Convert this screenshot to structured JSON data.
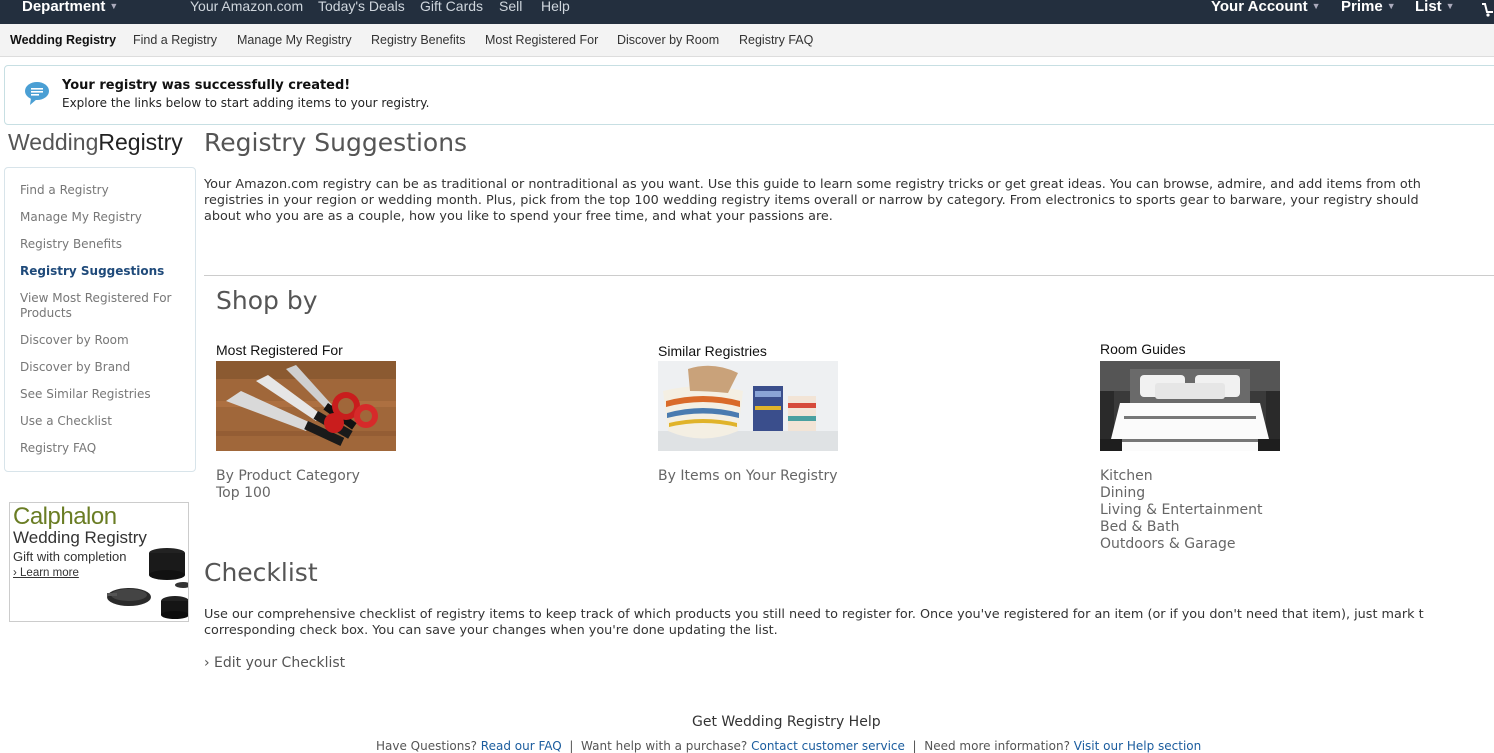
{
  "topnav": {
    "department": "Department",
    "links": [
      "Your Amazon.com",
      "Today's Deals",
      "Gift Cards",
      "Sell",
      "Help"
    ],
    "account": "Your Account",
    "prime": "Prime",
    "list": "List"
  },
  "subnav": {
    "items": [
      "Wedding Registry",
      "Find a Registry",
      "Manage My Registry",
      "Registry Benefits",
      "Most Registered For",
      "Discover by Room",
      "Registry FAQ"
    ]
  },
  "alert": {
    "title": "Your registry was successfully created!",
    "message": "Explore the links below to start adding items to your registry."
  },
  "sidebar": {
    "logo_light": "Wedding",
    "logo_strong": "Registry",
    "items": [
      {
        "label": "Find a Registry"
      },
      {
        "label": "Manage My Registry"
      },
      {
        "label": "Registry Benefits"
      },
      {
        "label": "Registry Suggestions",
        "active": true
      },
      {
        "label": "View Most Registered For Products"
      },
      {
        "label": "Discover by Room"
      },
      {
        "label": "Discover by Brand"
      },
      {
        "label": "See Similar Registries"
      },
      {
        "label": "Use a Checklist"
      },
      {
        "label": "Registry FAQ"
      }
    ]
  },
  "ad": {
    "brand": "Calphalon",
    "line2": "Wedding Registry",
    "line3": "Gift with completion",
    "learn": "Learn more"
  },
  "main": {
    "title": "Registry Suggestions",
    "intro": [
      "Your Amazon.com registry can be as traditional or nontraditional as you want. Use this guide to learn some registry tricks or get great ideas. You can browse, admire, and add items from oth",
      "registries in your region or wedding month. Plus, pick from the top 100 wedding registry items overall or narrow by category. From electronics to sports gear to barware, your registry should",
      "about who you are as a couple, how you like to spend your free time, and what your passions are."
    ],
    "shop_by": "Shop by",
    "columns": [
      {
        "title": "Most Registered For",
        "links": [
          "By Product Category",
          "Top 100"
        ]
      },
      {
        "title": "Similar Registries",
        "links": [
          "By Items on Your Registry"
        ]
      },
      {
        "title": "Room Guides",
        "links": [
          "Kitchen",
          "Dining",
          "Living & Entertainment",
          "Bed & Bath",
          "Outdoors & Garage"
        ]
      }
    ],
    "checklist_title": "Checklist",
    "checklist_text": [
      "Use our comprehensive checklist of registry items to keep track of which products you still need to register for. Once you've registered for an item (or if you don't need that item), just mark t",
      "corresponding check box. You can save your changes when you're done updating the list."
    ],
    "edit_checklist": "› Edit your Checklist"
  },
  "footer": {
    "help_title": "Get Wedding Registry Help",
    "q1": "Have Questions?",
    "q1_link": "Read our FAQ",
    "sep": "|",
    "q2": "Want help with a purchase?",
    "q2_link": "Contact customer service",
    "q3": "Need more information?",
    "q3_link": "Visit our Help section"
  }
}
